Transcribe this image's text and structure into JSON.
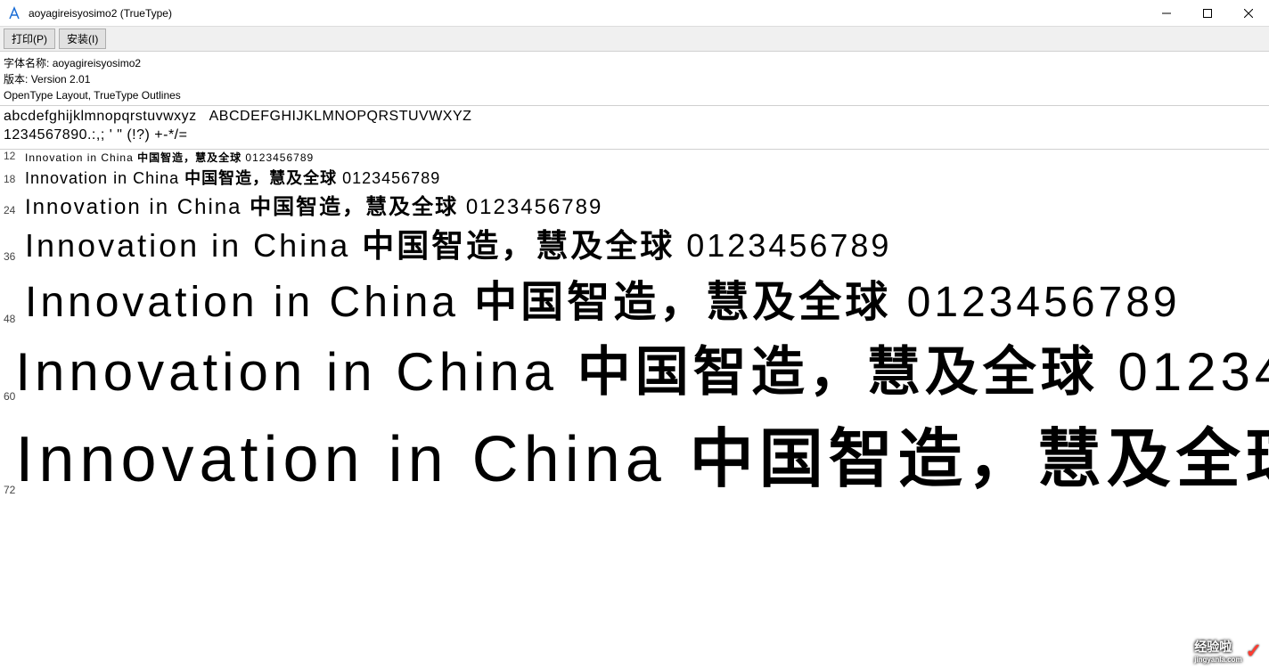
{
  "window": {
    "title": "aoyagireisyosimo2 (TrueType)"
  },
  "toolbar": {
    "print_label": "打印(P)",
    "install_label": "安装(I)"
  },
  "meta": {
    "font_name_label": "字体名称:",
    "font_name": "aoyagireisyosimo2",
    "version_label": "版本:",
    "version": "Version 2.01",
    "layout_info": "OpenType Layout, TrueType Outlines"
  },
  "alphabet": {
    "lower": "abcdefghijklmnopqrstuvwxyz",
    "upper": "ABCDEFGHIJKLMNOPQRSTUVWXYZ",
    "digits_symbols": "1234567890.:,; ' \" (!?) +-*/="
  },
  "sample_text": "Innovation in China 中国智造，慧及全球 0123456789",
  "samples": [
    {
      "size": "12",
      "class": "s12"
    },
    {
      "size": "18",
      "class": "s18"
    },
    {
      "size": "24",
      "class": "s24"
    },
    {
      "size": "36",
      "class": "s36"
    },
    {
      "size": "48",
      "class": "s48"
    },
    {
      "size": "60",
      "class": "s60"
    },
    {
      "size": "72",
      "class": "s72"
    }
  ],
  "watermark": {
    "main": "经验啦",
    "sub": "jingyanla.com",
    "check": "✓"
  }
}
